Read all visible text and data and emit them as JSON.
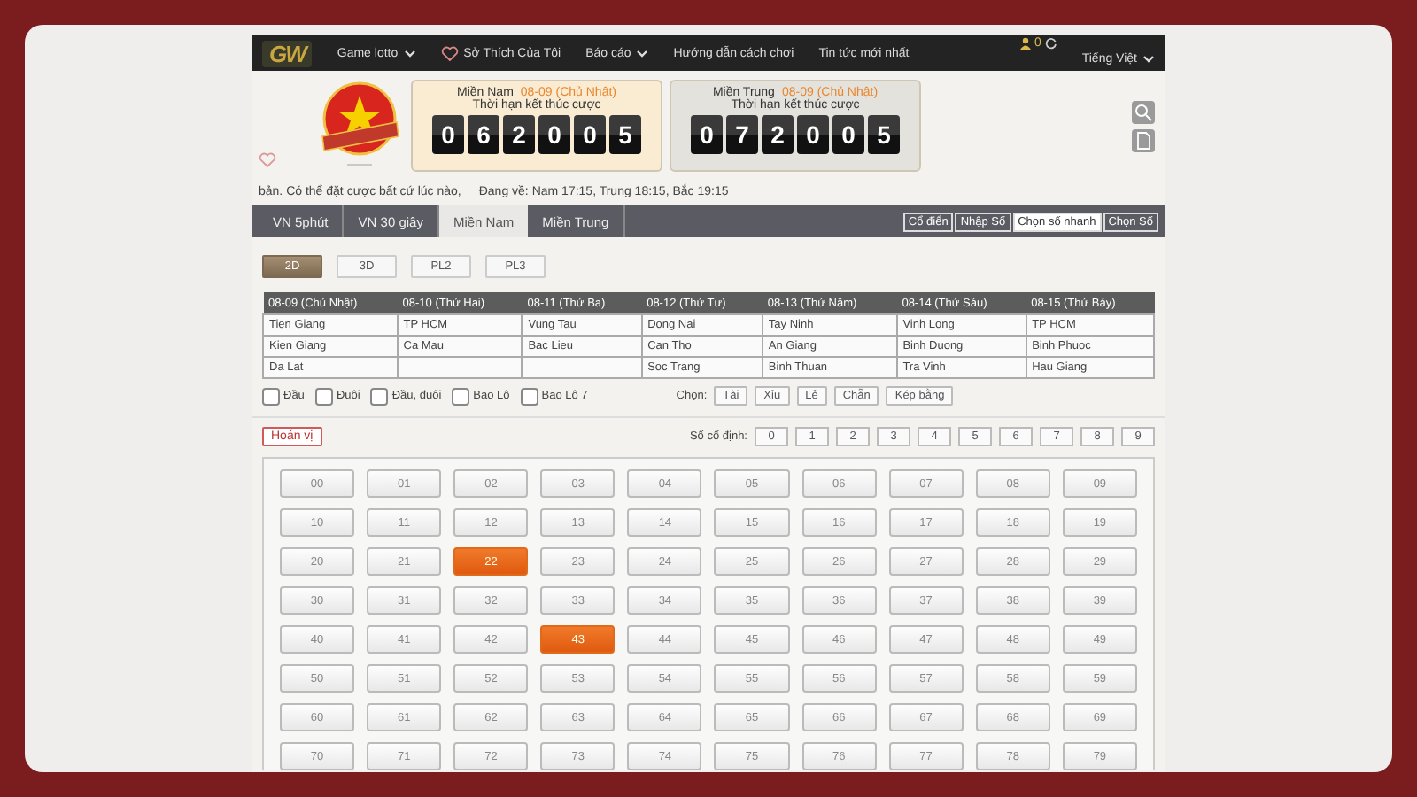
{
  "nav": {
    "logo": "GW",
    "items": [
      {
        "label": "Game lotto",
        "kind": "dropdown"
      },
      {
        "label": "Sở Thích Của Tôi",
        "kind": "favorite"
      },
      {
        "label": "Báo cáo",
        "kind": "dropdown"
      },
      {
        "label": "Hướng dẫn cách chơi",
        "kind": "link"
      },
      {
        "label": "Tin tức mới nhất",
        "kind": "link"
      }
    ],
    "user_count": "0",
    "language": "Tiếng Việt"
  },
  "countdowns": [
    {
      "region": "Miền Nam",
      "date": "08-09 (Chủ Nhật)",
      "caption": "Thời hạn kết thúc cược",
      "digits": [
        "0",
        "6",
        "2",
        "0",
        "0",
        "5"
      ],
      "selected": true
    },
    {
      "region": "Miền Trung",
      "date": "08-09 (Chủ Nhật)",
      "caption": "Thời hạn kết thúc cược",
      "digits": [
        "0",
        "7",
        "2",
        "0",
        "0",
        "5"
      ],
      "selected": false
    }
  ],
  "notice": {
    "text": "bản. Có thể đặt cược bất cứ lúc nào,",
    "schedule": "Đang về: Nam 17:15, Trung 18:15, Bắc 19:15"
  },
  "region_tabs": [
    {
      "label": "VN 5phút",
      "selected": false
    },
    {
      "label": "VN 30 giây",
      "selected": false
    },
    {
      "label": "Miền Nam",
      "selected": true
    },
    {
      "label": "Miền Trung",
      "selected": false
    }
  ],
  "mode_tabs": [
    {
      "label": "Cổ điển",
      "selected": false
    },
    {
      "label": "Nhập Số",
      "selected": false
    },
    {
      "label": "Chọn số nhanh",
      "selected": true
    },
    {
      "label": "Chọn Số",
      "selected": false
    }
  ],
  "game_types": [
    {
      "label": "2D",
      "selected": true
    },
    {
      "label": "3D",
      "selected": false
    },
    {
      "label": "PL2",
      "selected": false
    },
    {
      "label": "PL3",
      "selected": false
    }
  ],
  "schedule_table": {
    "columns": [
      "08-09 (Chủ Nhật)",
      "08-10 (Thứ Hai)",
      "08-11 (Thứ Ba)",
      "08-12 (Thứ Tư)",
      "08-13 (Thứ Năm)",
      "08-14 (Thứ Sáu)",
      "08-15 (Thứ Bảy)"
    ],
    "rows": [
      [
        "Tien Giang",
        "TP HCM",
        "Vung Tau",
        "Dong Nai",
        "Tay Ninh",
        "Vinh Long",
        "TP HCM"
      ],
      [
        "Kien Giang",
        "Ca Mau",
        "Bac Lieu",
        "Can Tho",
        "An Giang",
        "Binh Duong",
        "Binh Phuoc"
      ],
      [
        "Da Lat",
        null,
        null,
        "Soc Trang",
        "Binh Thuan",
        "Tra Vinh",
        "Hau Giang"
      ]
    ]
  },
  "options": [
    {
      "label": "Đầu",
      "checked": false
    },
    {
      "label": "Đuôi",
      "checked": false
    },
    {
      "label": "Đầu, đuôi",
      "checked": false
    },
    {
      "label": "Bao Lô",
      "checked": false
    },
    {
      "label": "Bao Lô 7",
      "checked": false
    }
  ],
  "choose": {
    "label": "Chọn:",
    "buttons": [
      "Tài",
      "Xỉu",
      "Lẻ",
      "Chẵn",
      "Kép bằng"
    ]
  },
  "permutation_button": "Hoán vị",
  "fixed_digits": {
    "label": "Số cố định:",
    "buttons": [
      "0",
      "1",
      "2",
      "3",
      "4",
      "5",
      "6",
      "7",
      "8",
      "9"
    ]
  },
  "numbers": [
    {
      "label": "00",
      "selected": false
    },
    {
      "label": "01",
      "selected": false
    },
    {
      "label": "02",
      "selected": false
    },
    {
      "label": "03",
      "selected": false
    },
    {
      "label": "04",
      "selected": false
    },
    {
      "label": "05",
      "selected": false
    },
    {
      "label": "06",
      "selected": false
    },
    {
      "label": "07",
      "selected": false
    },
    {
      "label": "08",
      "selected": false
    },
    {
      "label": "09",
      "selected": false
    },
    {
      "label": "10",
      "selected": false
    },
    {
      "label": "11",
      "selected": false
    },
    {
      "label": "12",
      "selected": false
    },
    {
      "label": "13",
      "selected": false
    },
    {
      "label": "14",
      "selected": false
    },
    {
      "label": "15",
      "selected": false
    },
    {
      "label": "16",
      "selected": false
    },
    {
      "label": "17",
      "selected": false
    },
    {
      "label": "18",
      "selected": false
    },
    {
      "label": "19",
      "selected": false
    },
    {
      "label": "20",
      "selected": false
    },
    {
      "label": "21",
      "selected": false
    },
    {
      "label": "22",
      "selected": true
    },
    {
      "label": "23",
      "selected": false
    },
    {
      "label": "24",
      "selected": false
    },
    {
      "label": "25",
      "selected": false
    },
    {
      "label": "26",
      "selected": false
    },
    {
      "label": "27",
      "selected": false
    },
    {
      "label": "28",
      "selected": false
    },
    {
      "label": "29",
      "selected": false
    },
    {
      "label": "30",
      "selected": false
    },
    {
      "label": "31",
      "selected": false
    },
    {
      "label": "32",
      "selected": false
    },
    {
      "label": "33",
      "selected": false
    },
    {
      "label": "34",
      "selected": false
    },
    {
      "label": "35",
      "selected": false
    },
    {
      "label": "36",
      "selected": false
    },
    {
      "label": "37",
      "selected": false
    },
    {
      "label": "38",
      "selected": false
    },
    {
      "label": "39",
      "selected": false
    },
    {
      "label": "40",
      "selected": false
    },
    {
      "label": "41",
      "selected": false
    },
    {
      "label": "42",
      "selected": false
    },
    {
      "label": "43",
      "selected": true
    },
    {
      "label": "44",
      "selected": false
    },
    {
      "label": "45",
      "selected": false
    },
    {
      "label": "46",
      "selected": false
    },
    {
      "label": "47",
      "selected": false
    },
    {
      "label": "48",
      "selected": false
    },
    {
      "label": "49",
      "selected": false
    },
    {
      "label": "50",
      "selected": false
    },
    {
      "label": "51",
      "selected": false
    },
    {
      "label": "52",
      "selected": false
    },
    {
      "label": "53",
      "selected": false
    },
    {
      "label": "54",
      "selected": false
    },
    {
      "label": "55",
      "selected": false
    },
    {
      "label": "56",
      "selected": false
    },
    {
      "label": "57",
      "selected": false
    },
    {
      "label": "58",
      "selected": false
    },
    {
      "label": "59",
      "selected": false
    },
    {
      "label": "60",
      "selected": false
    },
    {
      "label": "61",
      "selected": false
    },
    {
      "label": "62",
      "selected": false
    },
    {
      "label": "63",
      "selected": false
    },
    {
      "label": "64",
      "selected": false
    },
    {
      "label": "65",
      "selected": false
    },
    {
      "label": "66",
      "selected": false
    },
    {
      "label": "67",
      "selected": false
    },
    {
      "label": "68",
      "selected": false
    },
    {
      "label": "69",
      "selected": false
    },
    {
      "label": "70",
      "selected": false
    },
    {
      "label": "71",
      "selected": false
    },
    {
      "label": "72",
      "selected": false
    },
    {
      "label": "73",
      "selected": false
    },
    {
      "label": "74",
      "selected": false
    },
    {
      "label": "75",
      "selected": false
    },
    {
      "label": "76",
      "selected": false
    },
    {
      "label": "77",
      "selected": false
    },
    {
      "label": "78",
      "selected": false
    },
    {
      "label": "79",
      "selected": false
    }
  ]
}
